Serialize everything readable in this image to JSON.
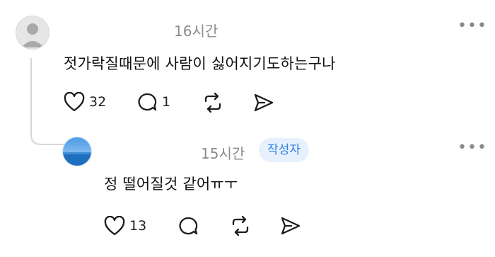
{
  "comments": [
    {
      "time": "16시간",
      "text": "젓가락질때문에 사람이 싫어지기도하는구나",
      "likes": "32",
      "replies": "1",
      "more": "•••"
    },
    {
      "time": "15시간",
      "badge": "작성자",
      "text": "정 떨어질것 같어ㅠㅜ",
      "likes": "13",
      "more": "•••"
    }
  ],
  "icons": {
    "avatar1": "default-user-avatar",
    "avatar2": "ocean-photo-avatar",
    "like": "heart-icon",
    "reply": "speech-bubble-icon",
    "repost": "repost-icon",
    "share": "send-icon",
    "more": "more-dots-icon"
  },
  "colors": {
    "badge_bg": "#e6f1fd",
    "badge_text": "#2e7fe3",
    "muted": "#8b8b8b"
  }
}
